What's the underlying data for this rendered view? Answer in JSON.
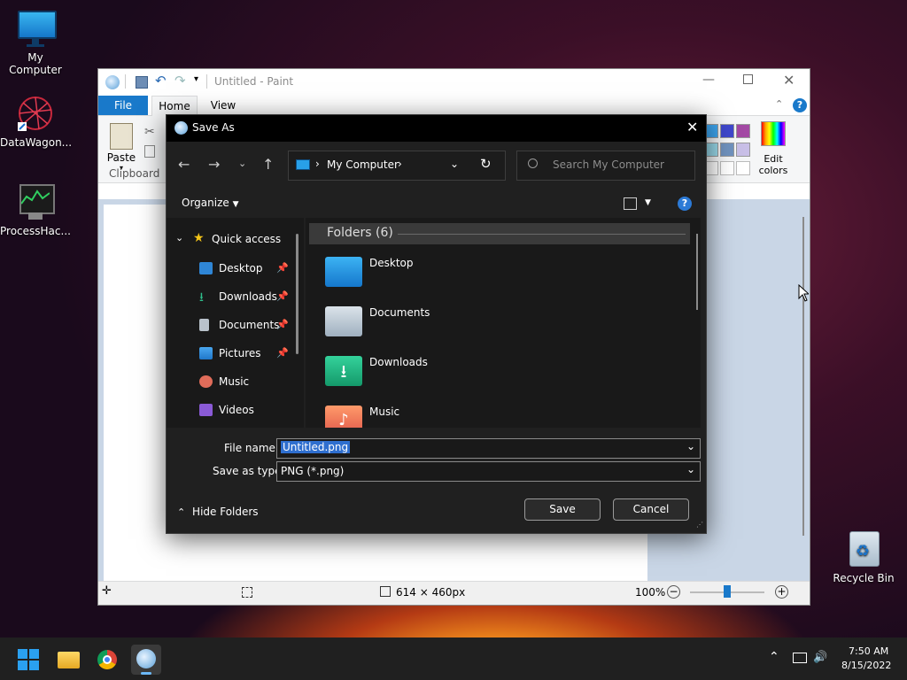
{
  "desktop": {
    "icons": [
      {
        "label": "My Computer"
      },
      {
        "label": "DataWagon..."
      },
      {
        "label": "ProcessHac..."
      },
      {
        "label": "Recycle Bin"
      }
    ]
  },
  "paint": {
    "title": "Untitled - Paint",
    "tabs": {
      "file": "File",
      "home": "Home",
      "view": "View"
    },
    "ribbon": {
      "paste": "Paste",
      "clipboard": "Clipboard",
      "edit_colors_1": "Edit",
      "edit_colors_2": "colors"
    },
    "status": {
      "dimensions": "614 × 460px",
      "zoom": "100%"
    }
  },
  "dialog": {
    "title": "Save As",
    "breadcrumb": "My Computer",
    "search_placeholder": "Search My Computer",
    "organize": "Organize",
    "nav": {
      "quick_access": "Quick access",
      "items": [
        {
          "label": "Desktop",
          "pinned": true
        },
        {
          "label": "Downloads",
          "pinned": true
        },
        {
          "label": "Documents",
          "pinned": true
        },
        {
          "label": "Pictures",
          "pinned": true
        },
        {
          "label": "Music",
          "pinned": false
        },
        {
          "label": "Videos",
          "pinned": false
        }
      ]
    },
    "folders_header": "Folders (6)",
    "folders": [
      {
        "label": "Desktop"
      },
      {
        "label": "Documents"
      },
      {
        "label": "Downloads"
      },
      {
        "label": "Music"
      }
    ],
    "file_name_label": "File name:",
    "file_name_value": "Untitled.png",
    "save_type_label": "Save as type:",
    "save_type_value": "PNG (*.png)",
    "hide_folders": "Hide Folders",
    "save": "Save",
    "cancel": "Cancel"
  },
  "taskbar": {
    "time": "7:50 AM",
    "date": "8/15/2022"
  },
  "colors": {
    "accent": "#0078d4",
    "dialog_bg": "#202020",
    "taskbar_bg": "#202020"
  }
}
